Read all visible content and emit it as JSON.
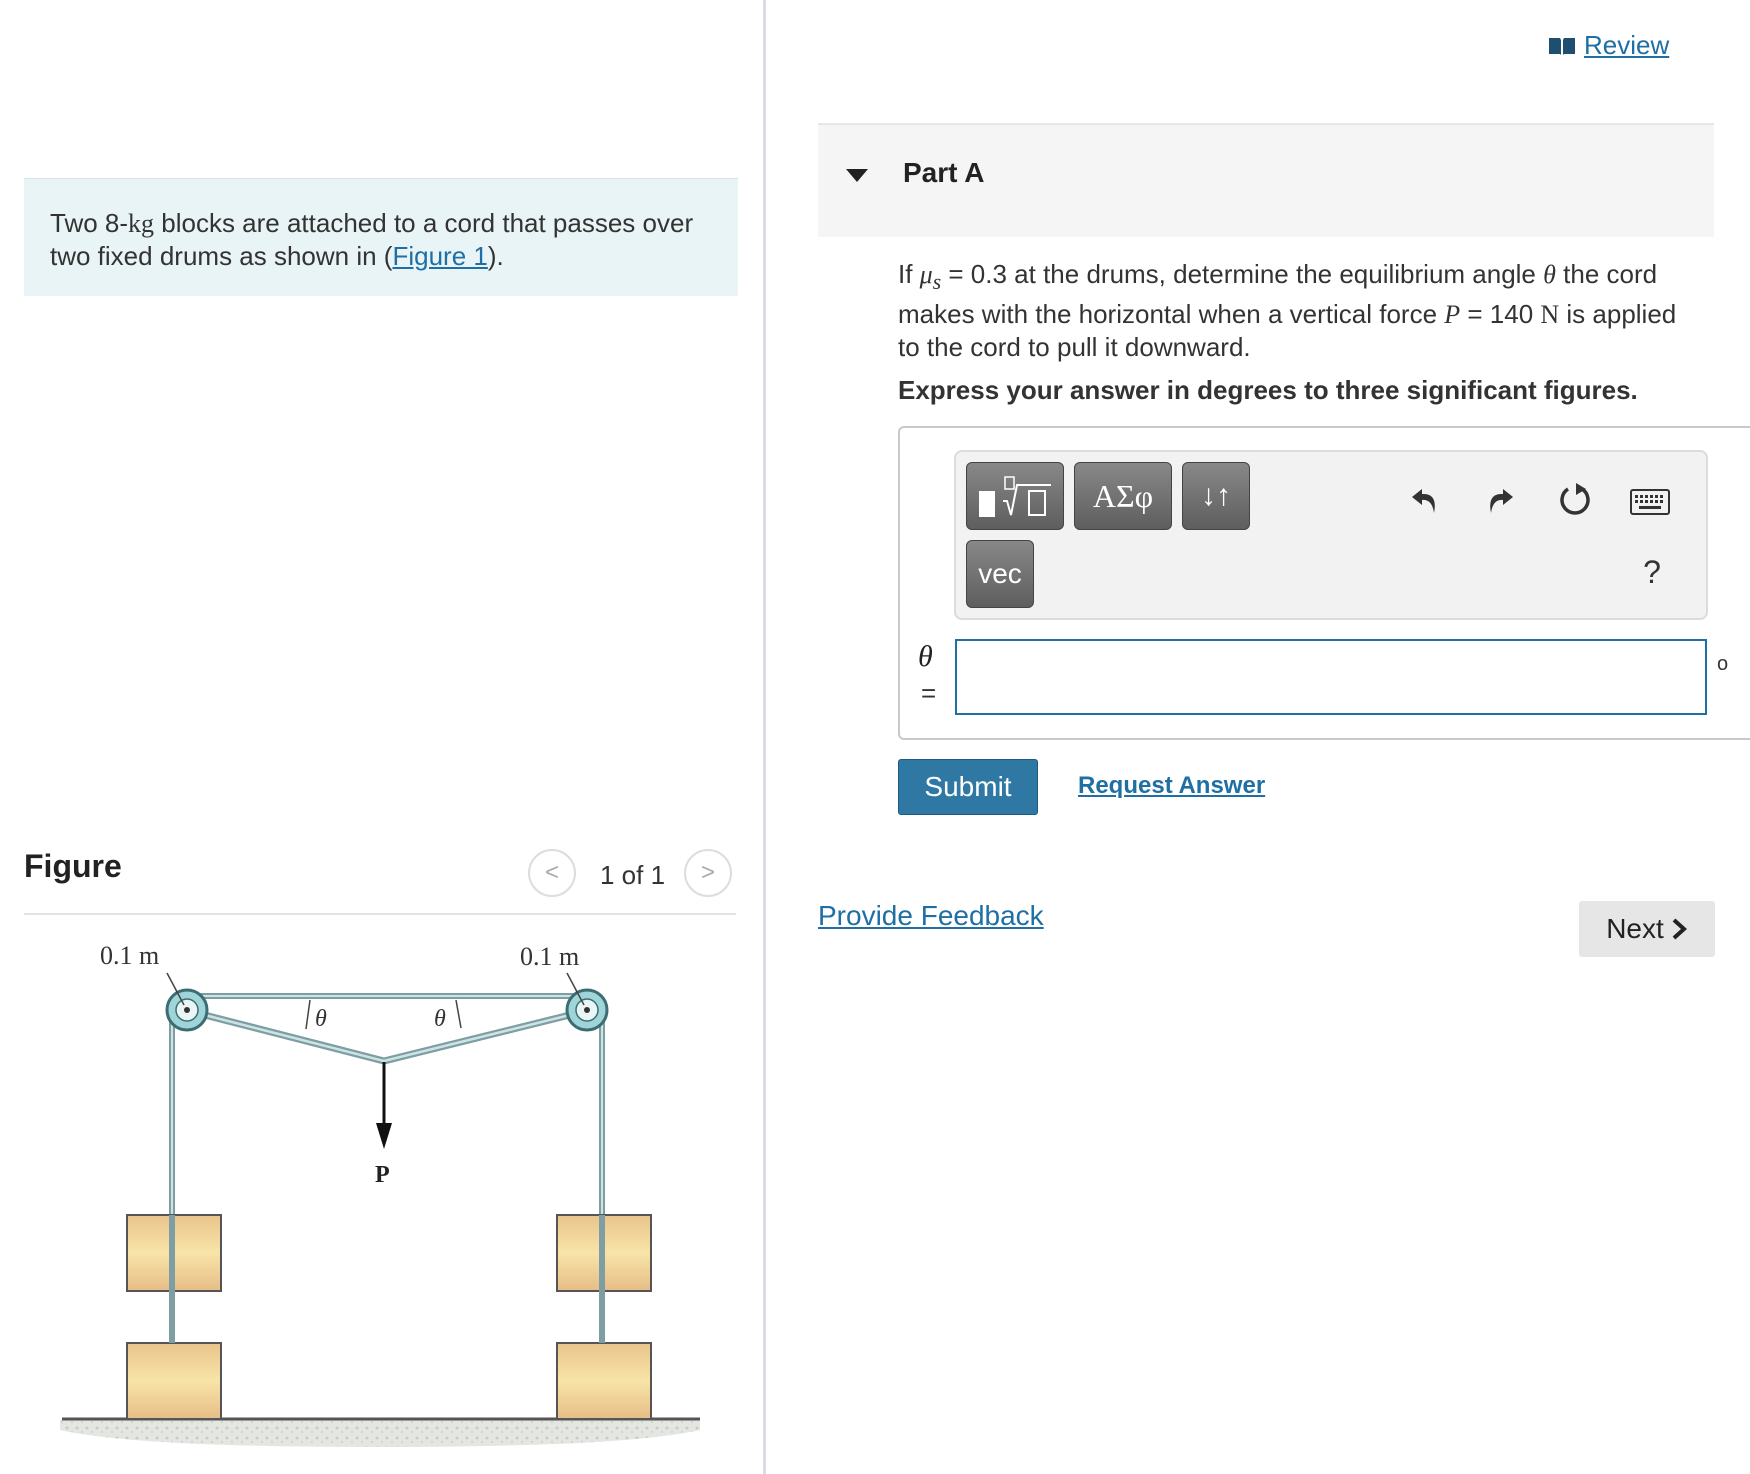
{
  "problem": {
    "text_before": "Two 8-",
    "unit": "kg",
    "text_mid": " blocks are attached to a cord that passes over two fixed drums as shown in (",
    "figure_link": "Figure 1",
    "text_after": ")."
  },
  "figure": {
    "title": "Figure",
    "pager": "1 of 1",
    "prev_glyph": "<",
    "next_glyph": ">",
    "labels": {
      "left_radius": "0.1 m",
      "right_radius": "0.1 m",
      "theta_left": "θ",
      "theta_right": "θ",
      "force": "P"
    }
  },
  "header": {
    "review_label": "Review"
  },
  "part": {
    "title": "Part A",
    "question": {
      "if": "If ",
      "mu": "μ",
      "mu_sub": "s",
      "q1": " = 0.3 at the drums, determine the equilibrium angle ",
      "theta": "θ",
      "q2": " the cord makes with the horizontal when a vertical force ",
      "p": "P",
      "q3": " = 140 ",
      "n": "N",
      "q4": " is applied to the cord to pull it downward."
    },
    "instruction": "Express your answer in degrees to three significant figures."
  },
  "toolbar": {
    "greek_label": "ΑΣφ",
    "arrows_label": "↓↑",
    "vec_label": "vec",
    "help_label": "?"
  },
  "answer": {
    "variable": "θ",
    "equals": "=",
    "value": "",
    "units": "o"
  },
  "actions": {
    "submit": "Submit",
    "request_answer": "Request Answer",
    "provide_feedback": "Provide Feedback",
    "next": "Next"
  }
}
